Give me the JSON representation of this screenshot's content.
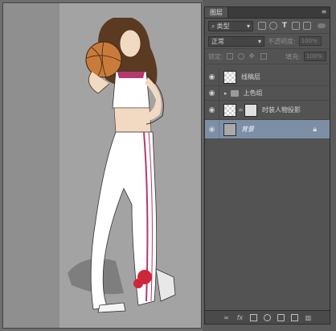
{
  "panel": {
    "tab_label": "图层",
    "menu_glyph": "≡",
    "filter": {
      "kind_label": "类型",
      "search_glyph": "⌕"
    },
    "blend": {
      "mode": "正常",
      "opacity_label": "不透明度:",
      "opacity_value": "100%"
    },
    "lock": {
      "label": "锁定:",
      "fill_label": "填充:",
      "fill_value": "100%"
    },
    "layers": [
      {
        "name": "线稿层",
        "type": "pixel",
        "visible": true,
        "selected": false
      },
      {
        "name": "上色组",
        "type": "group",
        "visible": true,
        "selected": false
      },
      {
        "name": "时装人物投影",
        "type": "pixel-masked",
        "visible": true,
        "selected": false
      },
      {
        "name": "背景",
        "type": "background",
        "visible": true,
        "selected": true,
        "locked": true
      }
    ],
    "footer_icons": [
      "link-icon",
      "fx-icon",
      "mask-icon",
      "adjustment-icon",
      "group-folder-icon",
      "new-layer-icon",
      "trash-icon"
    ]
  },
  "colors": {
    "selected_layer": "#7c8fa6",
    "panel_bg": "#535353",
    "canvas_bg": "#a3a3a3"
  }
}
